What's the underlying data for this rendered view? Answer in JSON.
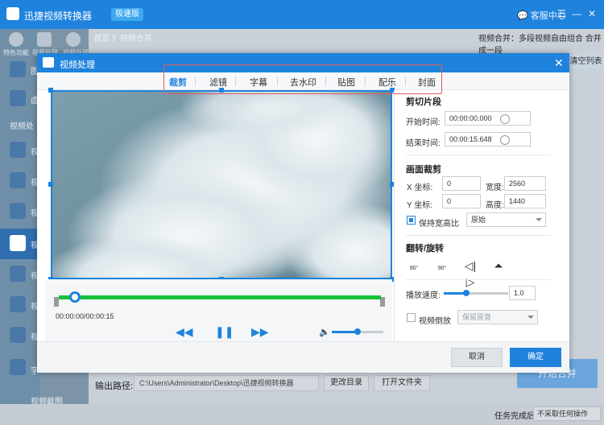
{
  "app": {
    "title": "迅捷视频转换器",
    "badge": "极速版",
    "service": "客服中心",
    "breadcrumb": "首页 》视频合并",
    "right_note": "视频合并：多段视频自由组合 合并成一段",
    "clear_list": "清空列表",
    "sidebar_items": [
      "特色功能",
      "视频处理",
      "视频处理"
    ],
    "section_label": "视频处",
    "side_letters": [
      "图",
      "虚",
      "视",
      "视",
      "视",
      "视",
      "视",
      "视",
      "视",
      "字"
    ],
    "output_label": "输出路径:",
    "output_path": "C:\\Users\\Administrator\\Desktop\\迅捷视频转换器",
    "change_dir": "更改目录",
    "open_folder": "打开文件夹",
    "merge": "开始合并",
    "after_done_label": "任务完成后",
    "after_done_value": "不采取任何操作",
    "bottom_item": "视频截图"
  },
  "dialog": {
    "title": "视频处理",
    "tabs": [
      "裁剪",
      "滤镜",
      "字幕",
      "去水印",
      "贴图",
      "配乐",
      "封面"
    ],
    "active_tab": "裁剪",
    "time_display": "00:00:00/00:00:15",
    "progress": 0.05,
    "volume": 0.5,
    "clip": {
      "title": "剪切片段",
      "start_label": "开始时间:",
      "start_value": "00:00:00.000",
      "end_label": "结束时间:",
      "end_value": "00:00:15.648"
    },
    "crop": {
      "title": "画面裁剪",
      "x_label": "X 坐标:",
      "x_value": "0",
      "y_label": "Y 坐标:",
      "y_value": "0",
      "width_label": "宽度:",
      "width_value": "2560",
      "height_label": "高度:",
      "height_value": "1440",
      "keep_ratio_label": "保持宽高比",
      "keep_ratio_checked": true,
      "ratio_value": "原始"
    },
    "flip": {
      "title": "翻转/旋转",
      "icons": [
        "rotate-left-90-icon",
        "rotate-right-90-icon",
        "flip-horizontal-icon",
        "flip-vertical-icon"
      ],
      "rot_left": "90°",
      "rot_right": "90°"
    },
    "speed": {
      "label": "播放速度:",
      "value": "1.0",
      "level": 0.35
    },
    "reverse": {
      "label": "视频倒放",
      "checked": false,
      "option": "保留原音"
    },
    "cancel": "取消",
    "ok": "确定"
  },
  "colors": {
    "accent": "#1f83dd",
    "track": "#19c23c",
    "highlight_box": "#e35a5a"
  }
}
